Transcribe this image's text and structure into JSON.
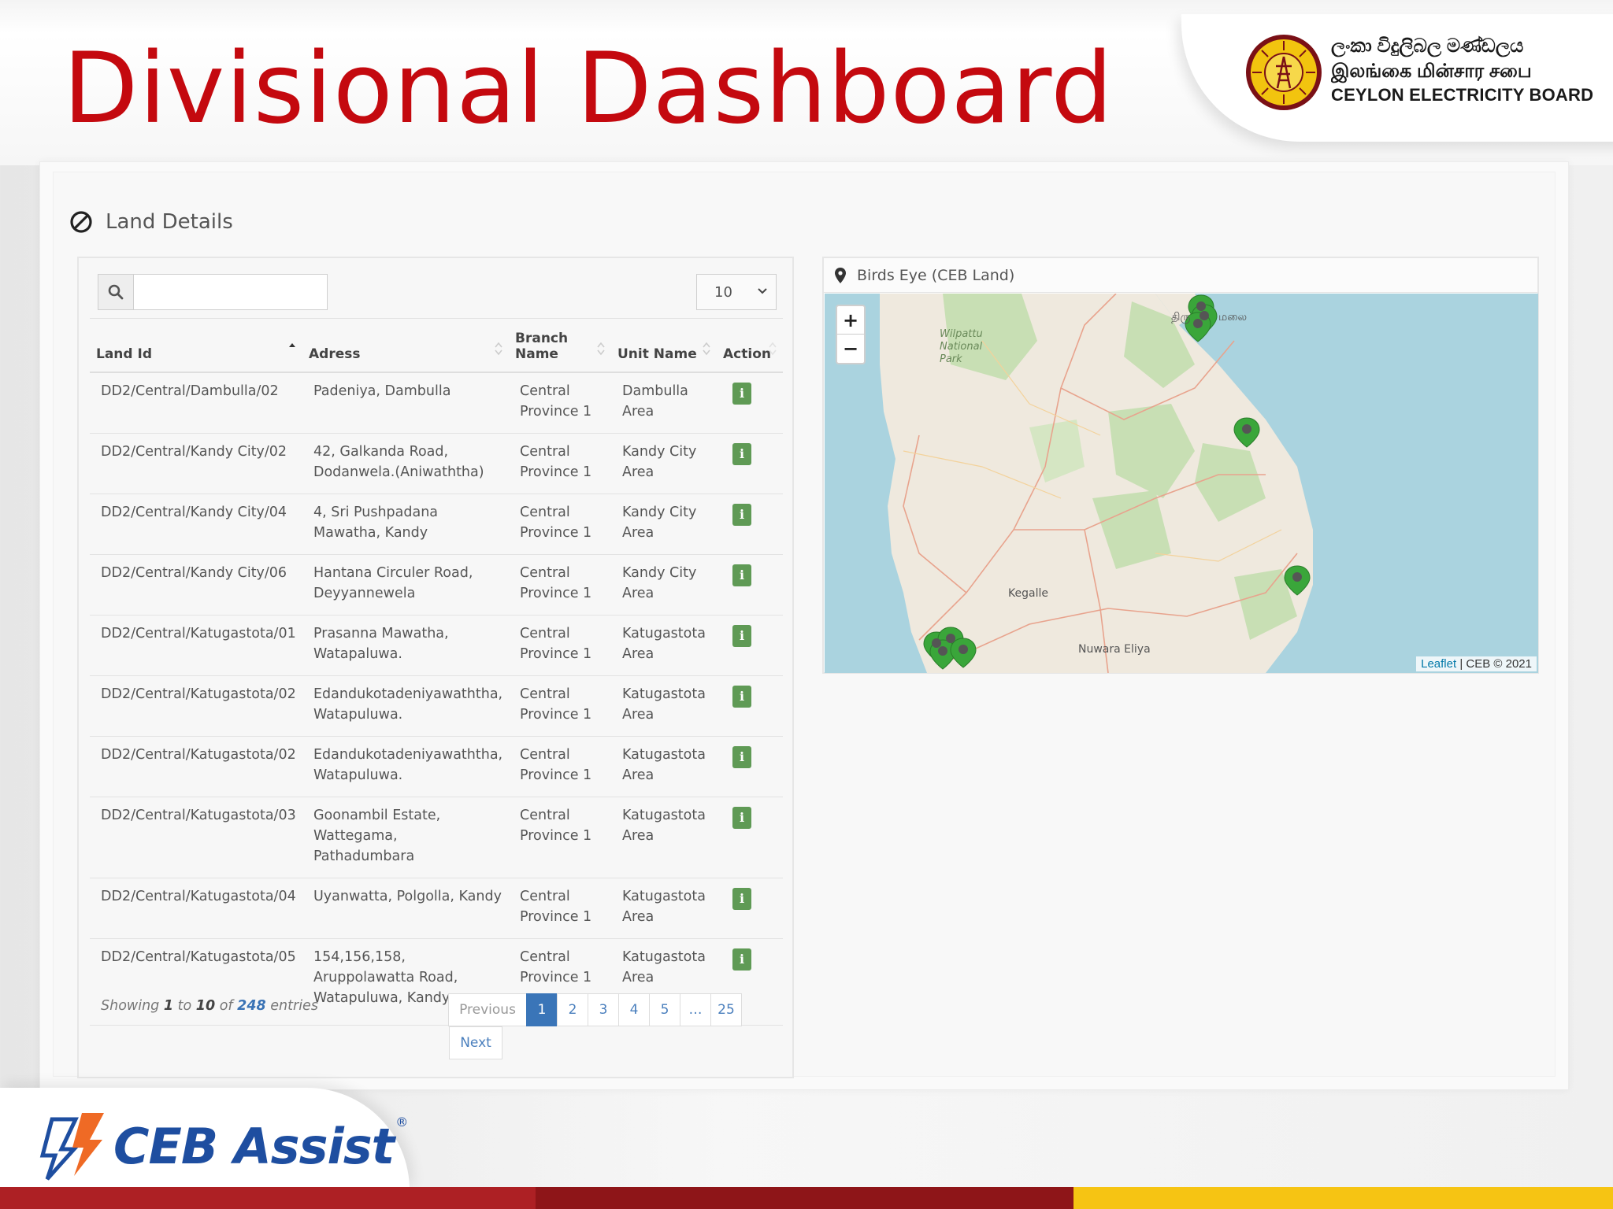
{
  "header": {
    "title": "Divisional Dashboard",
    "org_sinhala": "ලංකා විදුලිබල මණ්ඩලය",
    "org_tamil": "இலங்கை மின்சார சபை",
    "org_english": "CEYLON ELECTRICITY BOARD",
    "title_color": "#c4090f"
  },
  "section": {
    "icon": "ban-icon",
    "title": "Land Details"
  },
  "table": {
    "search": {
      "icon": "search-icon",
      "value": "",
      "placeholder": ""
    },
    "page_length": "10",
    "columns": [
      "Land Id",
      "Adress",
      "Branch Name",
      "Unit Name",
      "Action"
    ],
    "rows": [
      {
        "land_id": "DD2/Central/Dambulla/02",
        "address": "Padeniya, Dambulla",
        "branch": "Central Province 1",
        "unit": "Dambulla Area",
        "action": "i"
      },
      {
        "land_id": "DD2/Central/Kandy City/02",
        "address": "42, Galkanda Road, Dodanwela.(Aniwaththa)",
        "branch": "Central Province 1",
        "unit": "Kandy City Area",
        "action": "i"
      },
      {
        "land_id": "DD2/Central/Kandy City/04",
        "address": "4, Sri Pushpadana Mawatha, Kandy",
        "branch": "Central Province 1",
        "unit": "Kandy City Area",
        "action": "i"
      },
      {
        "land_id": "DD2/Central/Kandy City/06",
        "address": "Hantana Circuler Road, Deyyannewela",
        "branch": "Central Province 1",
        "unit": "Kandy City Area",
        "action": "i"
      },
      {
        "land_id": "DD2/Central/Katugastota/01",
        "address": "Prasanna Mawatha, Watapaluwa.",
        "branch": "Central Province 1",
        "unit": "Katugastota Area",
        "action": "i"
      },
      {
        "land_id": "DD2/Central/Katugastota/02",
        "address": "Edandukotadeniyawaththa, Watapuluwa.",
        "branch": "Central Province 1",
        "unit": "Katugastota Area",
        "action": "i"
      },
      {
        "land_id": "DD2/Central/Katugastota/02",
        "address": "Edandukotadeniyawaththa, Watapuluwa.",
        "branch": "Central Province 1",
        "unit": "Katugastota Area",
        "action": "i"
      },
      {
        "land_id": "DD2/Central/Katugastota/03",
        "address": "Goonambil Estate, Wattegama, Pathadumbara",
        "branch": "Central Province 1",
        "unit": "Katugastota Area",
        "action": "i"
      },
      {
        "land_id": "DD2/Central/Katugastota/04",
        "address": "Uyanwatta, Polgolla, Kandy",
        "branch": "Central Province 1",
        "unit": "Katugastota Area",
        "action": "i"
      },
      {
        "land_id": "DD2/Central/Katugastota/05",
        "address": "154,156,158, Aruppolawatta Road, Watapuluwa, Kandy",
        "branch": "Central Province 1",
        "unit": "Katugastota Area",
        "action": "i"
      }
    ],
    "summary": {
      "prefix": "Showing",
      "from": "1",
      "to_word": "to",
      "to": "10",
      "of_word": "of",
      "total": "248",
      "suffix": "entries"
    },
    "pagination": {
      "previous": "Previous",
      "pages": [
        "1",
        "2",
        "3",
        "4",
        "5",
        "…",
        "25"
      ],
      "active": "1",
      "next": "Next"
    }
  },
  "map": {
    "pin_icon": "map-marker-icon",
    "title": "Birds Eye (CEB Land)",
    "zoom_in": "+",
    "zoom_out": "−",
    "attribution_link": "Leaflet",
    "attribution_text": "| CEB © 2021",
    "labels": {
      "wilpattu": "Wilpattu National Park",
      "kegalle": "Kegalle",
      "nuwara_eliya": "Nuwara Eliya",
      "tiru": "திரு",
      "mala": "மலை"
    },
    "marker_color": "#3aa63a"
  },
  "footer": {
    "brand_name": "CEB Assist",
    "brand_reg": "®",
    "colors": {
      "red": "#ad2024",
      "maroon": "#8e1518",
      "yellow": "#f6c413",
      "brand_blue": "#1e4ea0",
      "brand_orange": "#ef6a25"
    }
  }
}
